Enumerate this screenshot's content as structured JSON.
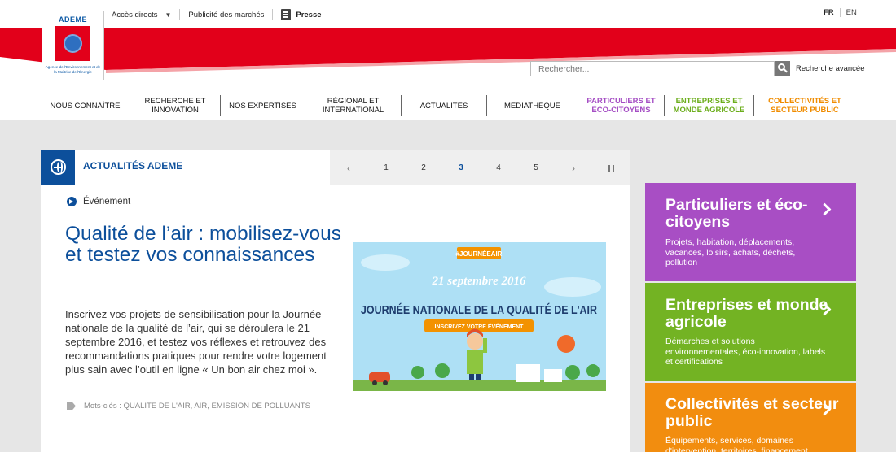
{
  "header": {
    "logo": {
      "brand": "ADEME",
      "tagline": "Agence de l'Environnement et de la Maîtrise de l'Énergie"
    },
    "topnav": {
      "direct_access": "Accès directs",
      "public_markets": "Publicité des marchés",
      "press": "Presse"
    },
    "lang": {
      "fr": "FR",
      "en": "EN"
    },
    "search": {
      "placeholder": "Rechercher...",
      "advanced": "Recherche avancée"
    },
    "colors": {
      "red": "#e2001a",
      "blue": "#0c4f9b"
    }
  },
  "main_nav": [
    {
      "label": "NOUS CONNAÎTRE"
    },
    {
      "label": "RECHERCHE ET INNOVATION"
    },
    {
      "label": "NOS EXPERTISES"
    },
    {
      "label": "RÉGIONAL ET INTERNATIONAL"
    },
    {
      "label": "ACTUALITÉS"
    },
    {
      "label": "MÉDIATHÈQUE"
    },
    {
      "label": "PARTICULIERS ET ÉCO-CITOYENS",
      "color": "#a54ec4"
    },
    {
      "label": "ENTREPRISES ET MONDE AGRICOLE",
      "color": "#6cae1c"
    },
    {
      "label": "COLLECTIVITÉS ET SECTEUR PUBLIC",
      "color": "#f08c00"
    }
  ],
  "news": {
    "title": "ACTUALITÉS ADEME",
    "pager": {
      "pages": [
        "1",
        "2",
        "3",
        "4",
        "5"
      ],
      "current": "3",
      "prev": "‹",
      "next": "›"
    },
    "category": "Événement",
    "article_title": "Qualité de l’air : mobilisez-vous et testez vos connaissances",
    "article_body": "Inscrivez vos projets de sensibilisation pour la Journée nationale de la qualité de l’air, qui se déroulera le 21 septembre 2016, et testez vos réflexes et retrouvez des recommandations pratiques pour rendre votre logement plus sain avec l’outil en ligne « Un bon air chez moi ».",
    "tags": "Mots-clés : QUALITE DE L'AIR, AIR, EMISSION DE POLLUANTS",
    "image": {
      "hashtag": "#JOURNÉEAIR",
      "date": "21 septembre 2016",
      "headline": "JOURNÉE NATIONALE DE LA QUALITÉ DE L'AIR",
      "cta": "INSCRIVEZ VOTRE ÉVÉNEMENT"
    }
  },
  "side_blocks": [
    {
      "title": "Particuliers et éco-citoyens",
      "desc": "Projets, habitation, déplacements, vacances, loisirs, achats, déchets, pollution",
      "color": "#a84ec4"
    },
    {
      "title": "Entreprises et monde agricole",
      "desc": "Démarches et solutions environnementales, éco-innovation, labels et certifications",
      "color": "#73b323"
    },
    {
      "title": "Collectivités et secteur public",
      "desc": "Équipements, services, domaines d'intervention, territoires, financement",
      "color": "#f28d0f"
    }
  ]
}
